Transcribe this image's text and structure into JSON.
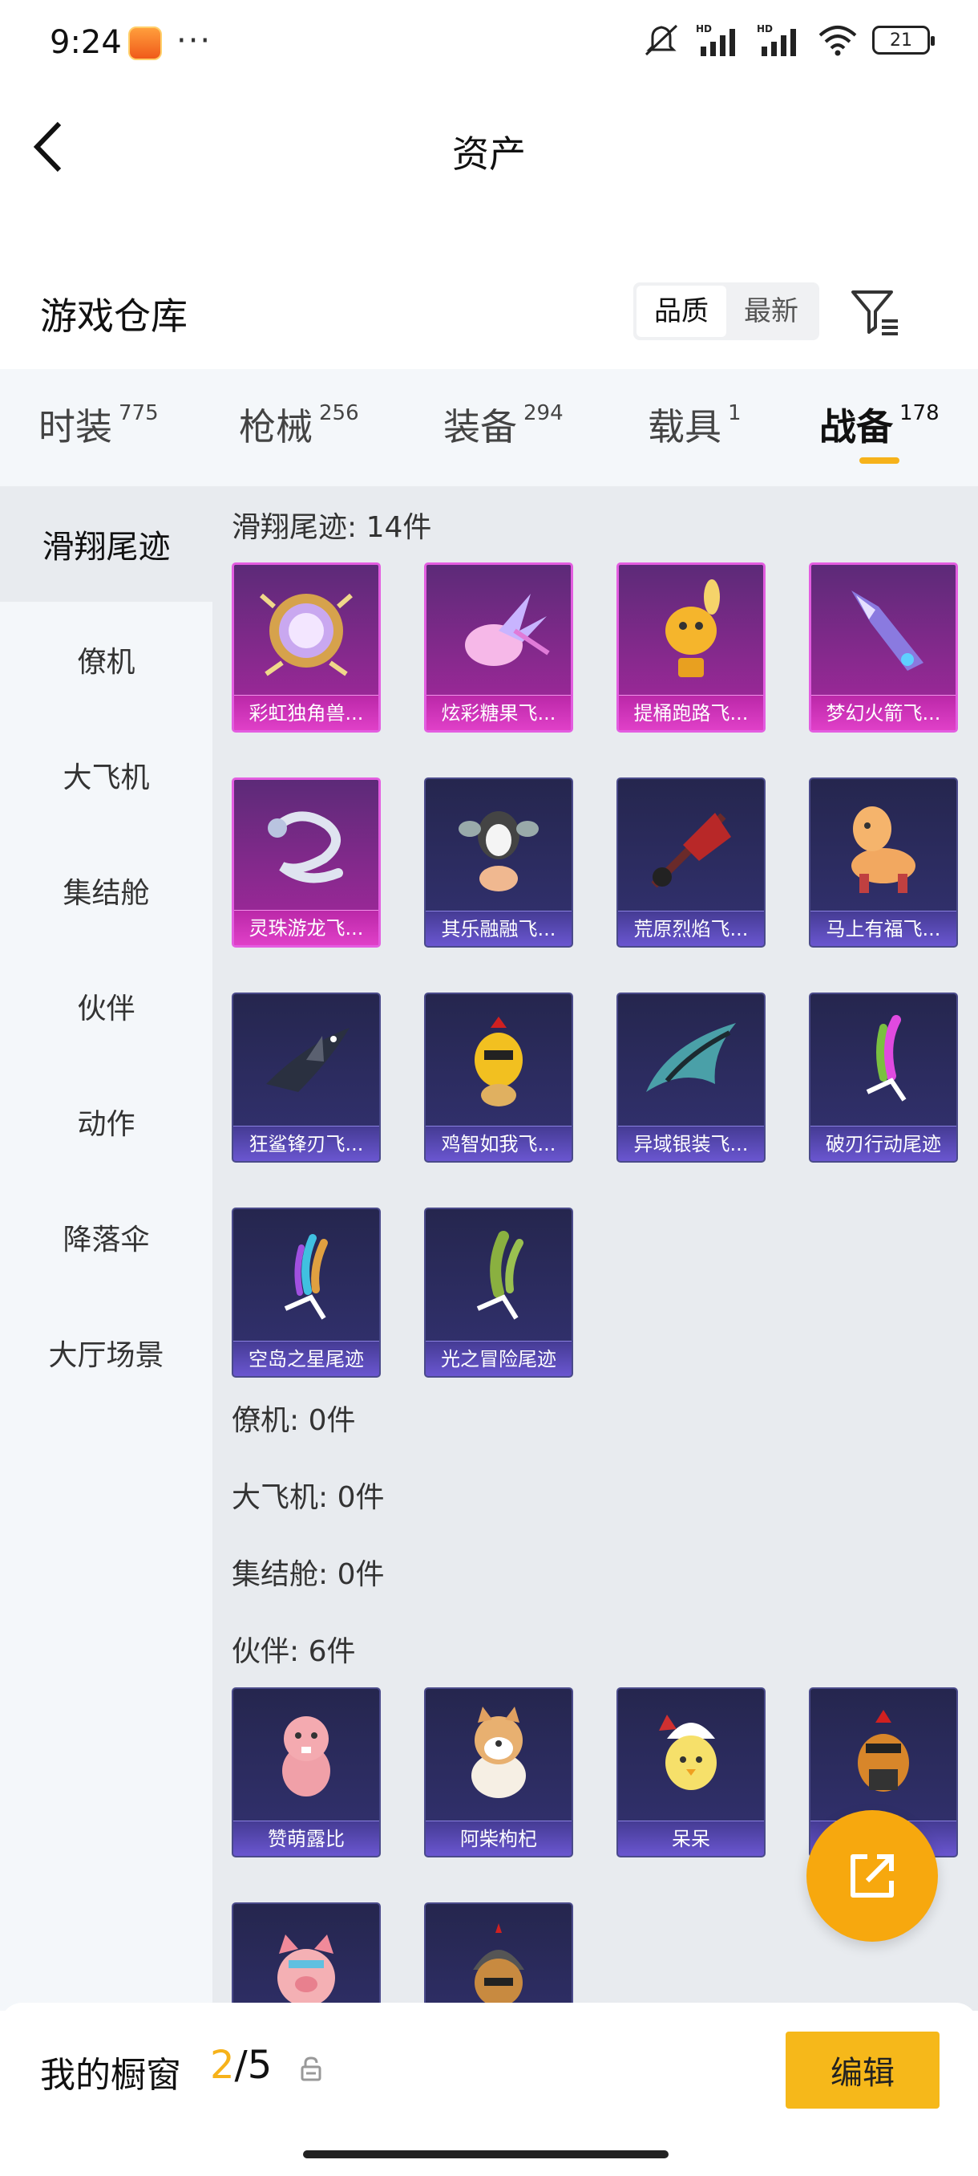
{
  "status": {
    "time": "9:24",
    "dots": "···",
    "battery": "21"
  },
  "nav": {
    "title": "资产"
  },
  "section": {
    "title": "游戏仓库",
    "sort_options": [
      "品质",
      "最新"
    ],
    "sort_active": "品质"
  },
  "tabs": [
    {
      "label": "时装",
      "count": "775"
    },
    {
      "label": "枪械",
      "count": "256"
    },
    {
      "label": "装备",
      "count": "294"
    },
    {
      "label": "载具",
      "count": "1"
    },
    {
      "label": "战备",
      "count": "178",
      "active": true
    }
  ],
  "sidebar": [
    {
      "label": "滑翔尾迹",
      "active": true
    },
    {
      "label": "僚机"
    },
    {
      "label": "大飞机"
    },
    {
      "label": "集结舱"
    },
    {
      "label": "伙伴"
    },
    {
      "label": "动作"
    },
    {
      "label": "降落伞"
    },
    {
      "label": "大厅场景"
    }
  ],
  "categories": {
    "glide": {
      "title": "滑翔尾迹: 14件"
    },
    "wingman": {
      "title": "僚机: 0件"
    },
    "plane": {
      "title": "大飞机: 0件"
    },
    "pod": {
      "title": "集结舱: 0件"
    },
    "partner": {
      "title": "伙伴: 6件"
    }
  },
  "glide_items": [
    {
      "name": "彩虹独角兽...",
      "quality": "purple",
      "icon": "unicorn-mirror-icon"
    },
    {
      "name": "炫彩糖果飞...",
      "quality": "purple",
      "icon": "candy-icon"
    },
    {
      "name": "提桶跑路飞...",
      "quality": "purple",
      "icon": "bee-bucket-icon"
    },
    {
      "name": "梦幻火箭飞...",
      "quality": "purple",
      "icon": "rocket-glider-icon"
    },
    {
      "name": "灵珠游龙飞...",
      "quality": "purple",
      "icon": "dragon-icon"
    },
    {
      "name": "其乐融融飞...",
      "quality": "blue",
      "icon": "penguin-icon"
    },
    {
      "name": "荒原烈焰飞...",
      "quality": "blue",
      "icon": "flame-glider-icon"
    },
    {
      "name": "马上有福飞...",
      "quality": "blue",
      "icon": "horse-icon"
    },
    {
      "name": "狂鲨锋刃飞...",
      "quality": "blue",
      "icon": "shark-icon"
    },
    {
      "name": "鸡智如我飞...",
      "quality": "blue",
      "icon": "chicken-icon"
    },
    {
      "name": "异域银装飞...",
      "quality": "blue",
      "icon": "wing-glider-icon"
    },
    {
      "name": "破刃行动尾迹",
      "quality": "blue",
      "icon": "trail-smoke-icon"
    },
    {
      "name": "空岛之星尾迹",
      "quality": "blue",
      "icon": "rainbow-trail-icon"
    },
    {
      "name": "光之冒险尾迹",
      "quality": "blue",
      "icon": "green-trail-icon"
    }
  ],
  "partner_items": [
    {
      "name": "赞萌露比",
      "quality": "blue",
      "icon": "beaver-icon"
    },
    {
      "name": "阿柴枸杞",
      "quality": "blue",
      "icon": "shiba-icon"
    },
    {
      "name": "呆呆",
      "quality": "blue",
      "icon": "chick-icon"
    },
    {
      "name": "",
      "quality": "blue",
      "icon": "rooster-icon"
    },
    {
      "name": "",
      "quality": "blue",
      "icon": "pig-icon"
    },
    {
      "name": "",
      "quality": "blue",
      "icon": "helmet-dog-icon"
    }
  ],
  "bottom": {
    "window_label": "我的橱窗",
    "current": "2",
    "total": "/5",
    "edit_label": "编辑"
  },
  "colors": {
    "accent": "#f6b21a",
    "purple_quality": "#e35de0",
    "blue_quality": "#6a56d0"
  }
}
